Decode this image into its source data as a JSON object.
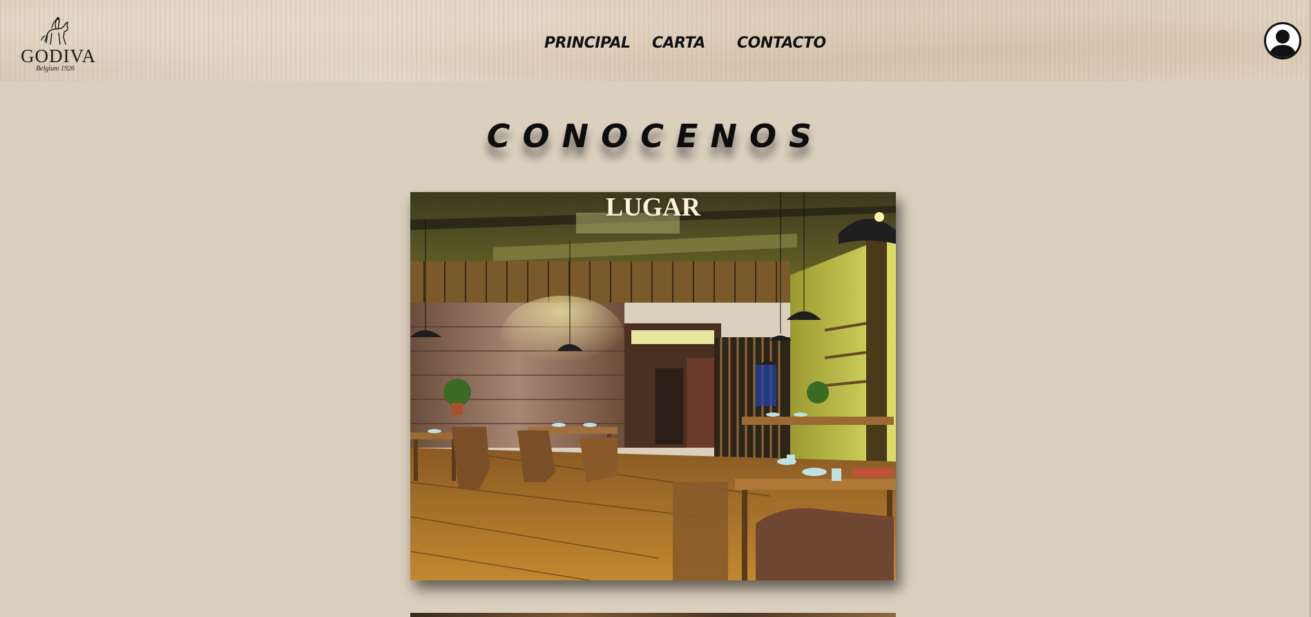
{
  "header": {
    "logo": {
      "name": "GODIVA",
      "tagline": "Belgium 1926"
    },
    "nav": [
      {
        "label": "PRINCIPAL"
      },
      {
        "label": "CARTA"
      },
      {
        "label": "CONTACTO"
      }
    ],
    "avatar_icon": "user-silhouette-icon"
  },
  "main": {
    "title": "CONOCENOS",
    "cards": [
      {
        "caption": "LUGAR",
        "image": "restaurant-interior"
      }
    ]
  },
  "colors": {
    "page_background": "#dbcfbe",
    "caption_text": "#fff3dc",
    "nav_text": "#111111"
  }
}
